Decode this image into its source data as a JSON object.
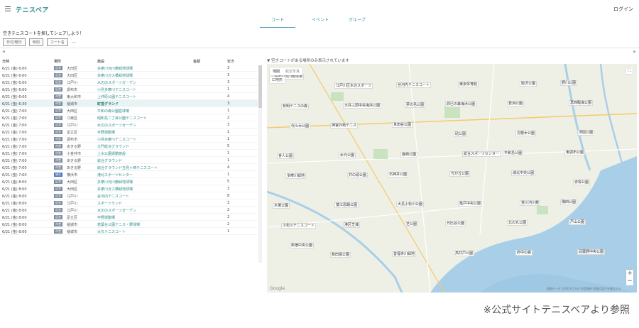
{
  "header": {
    "title": "テニスベア",
    "login": "ログイン"
  },
  "tabs": [
    {
      "label": "コート"
    },
    {
      "label": "イベント"
    },
    {
      "label": "グループ"
    }
  ],
  "lead": "空きテニスコートを探してシェアしよう！",
  "filters": [
    "日付/曜日",
    "時刻",
    "コート名",
    "―"
  ],
  "table": {
    "headers": [
      "日時",
      "場所",
      "施設",
      "金額",
      "空き"
    ],
    "rows": [
      {
        "date": "6/21 (金) 6:00",
        "badge": "区営",
        "city": "大田区",
        "place": "多摩川河川敷緑地球場",
        "vac": "3"
      },
      {
        "date": "6/21 (金) 6:00",
        "badge": "区営",
        "city": "大田区",
        "place": "多摩川ガス橋緑地球場",
        "vac": "3"
      },
      {
        "date": "6/21 (金) 6:00",
        "badge": "区営",
        "city": "江戸川",
        "place": "水辺のスポーツガーデン",
        "vac": "3"
      },
      {
        "date": "6/21 (金) 6:00",
        "badge": "区営",
        "city": "調布市",
        "place": "小島多摩川テニスコート",
        "vac": "1"
      },
      {
        "date": "6/21 (金) 6:00",
        "badge": "市営",
        "city": "東大和市",
        "place": "上仲原公園テニスコート",
        "vac": "4"
      },
      {
        "date": "6/21 (金) 6:30",
        "badge": "市営",
        "city": "稲城市",
        "place": "町営グランド",
        "vac": "3"
      },
      {
        "date": "6/21 (金) 7:00",
        "badge": "区営",
        "city": "大田区",
        "place": "平和の森公園庭球場",
        "vac": "1"
      },
      {
        "date": "6/21 (金) 7:00",
        "badge": "区営",
        "city": "江東区",
        "place": "昭和島二丁目公園テニスコート",
        "vac": "2"
      },
      {
        "date": "6/21 (金) 7:00",
        "badge": "区営",
        "city": "江戸川",
        "place": "水辺のスポーツガーデン",
        "vac": "3"
      },
      {
        "date": "6/21 (金) 7:00",
        "badge": "区営",
        "city": "足立区",
        "place": "宇野運動場",
        "vac": "1"
      },
      {
        "date": "6/21 (金) 7:00",
        "badge": "市営",
        "city": "調布市",
        "place": "小島多摩川テニスコート",
        "vac": "1"
      },
      {
        "date": "6/21 (金) 7:00",
        "badge": "市営",
        "city": "あきる野",
        "place": "大門総合グラウンド",
        "vac": "5"
      },
      {
        "date": "6/21 (金) 7:00",
        "badge": "市営",
        "city": "小金井市",
        "place": "上水公園運動施設",
        "vac": "1"
      },
      {
        "date": "6/21 (金) 7:00",
        "badge": "市営",
        "city": "あきる野",
        "place": "総合グラウンド",
        "vac": "1"
      },
      {
        "date": "6/21 (金) 7:00",
        "badge": "市営",
        "city": "あきる野",
        "place": "総合グラウンド玉見ヶ崎テニスコート",
        "vac": "4"
      },
      {
        "date": "6/21 (金) 7:00",
        "badge": "横浜",
        "city": "横浜市",
        "place": "港北スポーツセンター",
        "vac": "1"
      },
      {
        "date": "6/21 (金) 8:00",
        "badge": "区営",
        "city": "大田区",
        "place": "多摩川河川敷緑地球場",
        "vac": "5"
      },
      {
        "date": "6/21 (金) 8:00",
        "badge": "区営",
        "city": "大田区",
        "place": "多摩川ガス橋緑地球場",
        "vac": "3"
      },
      {
        "date": "6/21 (金) 8:00",
        "badge": "区営",
        "city": "江戸川",
        "place": "谷河内テニスコート",
        "vac": "8"
      },
      {
        "date": "6/21 (金) 8:00",
        "badge": "区営",
        "city": "江戸川",
        "place": "スポーツランド",
        "vac": "3"
      },
      {
        "date": "6/21 (金) 8:00",
        "badge": "区営",
        "city": "江戸川",
        "place": "水辺のスポーツガーデン",
        "vac": "2"
      },
      {
        "date": "6/21 (金) 8:00",
        "badge": "区営",
        "city": "足立区",
        "place": "宇野運動場",
        "vac": "2"
      },
      {
        "date": "6/21 (金) 8:00",
        "badge": "市営",
        "city": "稲城市",
        "place": "若葉台公園テニス・野球場",
        "vac": "2"
      },
      {
        "date": "6/21 (金) 8:00",
        "badge": "市営",
        "city": "稲城市",
        "place": "大丸テニスコート",
        "vac": "1"
      }
    ]
  },
  "map": {
    "note": "空きコートがある場所のみ表示されています",
    "map_type": [
      "地図",
      "航空写真"
    ],
    "terrain": "口地形",
    "fullscreen": "⛶",
    "zoom_in": "+",
    "zoom_out": "−",
    "google": "Google",
    "credit": "地図データ ©2019  2 km  利用規約  地図の誤りを報告する",
    "labels": [
      "多摩川河川敷球場",
      "江戸川区水辺スポーツ",
      "谷河内テニスコート",
      "東京体育館",
      "駒沢公園",
      "野川公園",
      "有明テニスの森",
      "大井ふ頭中央海浜公園",
      "夢の島公園",
      "辰巳の森海浜公園",
      "若洲公園",
      "葛西臨海公園",
      "代々木公園",
      "神宮外苑テニス",
      "世田谷公園",
      "砧公園",
      "羽根木公園",
      "浮間公園",
      "舎人公園",
      "水元公園",
      "篠崎公園",
      "総合スポーツセンター",
      "平和島公園",
      "東調布公園",
      "多摩川緑地",
      "井の頭公園",
      "石神井公園",
      "光が丘公園",
      "城北中央公園",
      "赤塚公園",
      "木場公園",
      "猿江恩賜公園",
      "大島小松川公園",
      "亀戸中央公園",
      "荒川河川敷",
      "隅田公園",
      "小松川テニスコート",
      "港区芝浦",
      "芝公園",
      "日比谷公園",
      "北の丸公園",
      "戸山公園",
      "新宿中央公園",
      "和田堀公園",
      "善福寺川緑地",
      "高井戸公園",
      "府中の森",
      "武蔵野中央公園"
    ]
  },
  "caption": "※公式サイトテニスベアより参照",
  "colors": {
    "accent": "#2a8a8e",
    "link": "#3a8fb0",
    "water": "#a9cfe8",
    "badge_blue": "#4e79b8"
  }
}
